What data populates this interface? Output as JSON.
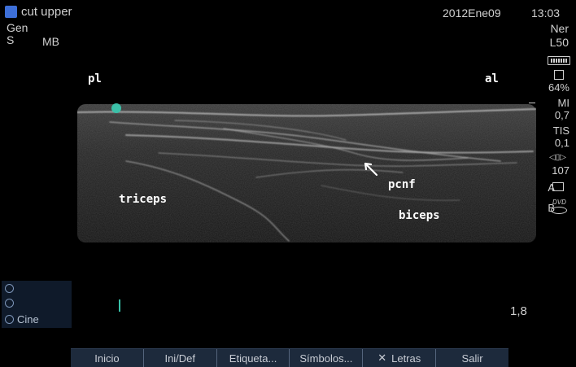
{
  "header": {
    "exam_name": "cut upper",
    "date": "2012Ene09",
    "time": "13:03",
    "preset": "Gen",
    "mode_s": "S",
    "mode_mb": "MB",
    "transducer_type": "Ner",
    "transducer_model": "L50"
  },
  "sidebar": {
    "storage_percent": "64%",
    "mi_label": "MI",
    "mi_value": "0,7",
    "tis_label": "TIS",
    "tis_value": "0,1",
    "frequency_value": "107",
    "printer_a": "A",
    "dvd_b": "B",
    "dvd_text": "DVD",
    "depth": "1,8"
  },
  "labels": {
    "pl": "pl",
    "al": "al",
    "triceps": "triceps",
    "pcnf": "pcnf",
    "biceps": "biceps"
  },
  "cine": {
    "cine_label": "Cine"
  },
  "toolbar": {
    "inicio": "Inicio",
    "inidef": "Ini/Def",
    "etiqueta": "Etiqueta...",
    "simbolos": "Símbolos...",
    "letras": "Letras",
    "salir": "Salir"
  },
  "colors": {
    "background": "#000000",
    "orientation_dot": "#3bc0a8",
    "toolbar_bg": "#1d2a3c",
    "app_icon": "#3d6fd8"
  }
}
